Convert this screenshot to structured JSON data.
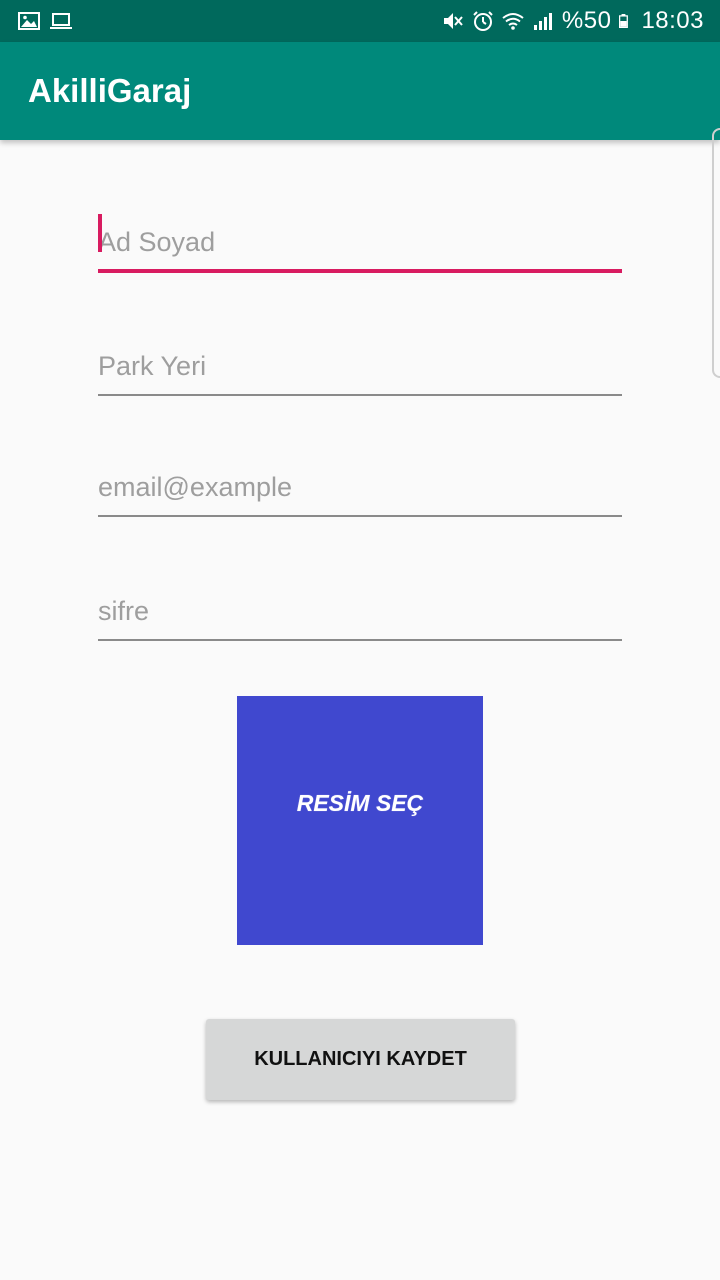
{
  "status_bar": {
    "left_icons": [
      "image-icon",
      "laptop-icon"
    ],
    "right_icons": [
      "mute-icon",
      "alarm-icon",
      "wifi-icon",
      "signal-icon"
    ],
    "battery_text": "%50",
    "battery_icon": "battery-icon",
    "time": "18:03"
  },
  "app_bar": {
    "title": "AkilliGaraj"
  },
  "form": {
    "name_placeholder": "Ad Soyad",
    "park_placeholder": "Park Yeri",
    "email_placeholder": "email@example",
    "password_placeholder": "sifre"
  },
  "image_picker": {
    "label": "RESİM SEÇ"
  },
  "save_button": {
    "label": "KULLANICIYI KAYDET"
  },
  "colors": {
    "status_bar": "#00695c",
    "app_bar": "#00897b",
    "accent": "#d81b60",
    "image_button": "#4048cf",
    "button_bg": "#d6d7d7",
    "background": "#fafafa"
  }
}
